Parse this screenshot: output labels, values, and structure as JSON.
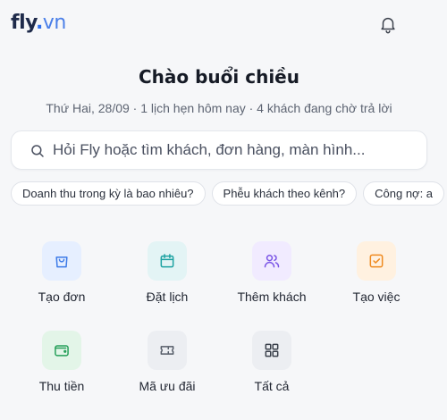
{
  "header": {
    "logo_main": "fly",
    "logo_dot": ".",
    "logo_tld": "vn",
    "bell_icon": "bell-icon"
  },
  "greeting": "Chào buổi chiều",
  "subline": "Thứ Hai, 28/09 · 1 lịch hẹn hôm nay · 4 khách đang chờ trả lời",
  "search": {
    "placeholder": "Hỏi Fly hoặc tìm khách, đơn hàng, màn hình...",
    "icon": "search-icon"
  },
  "chips": [
    "Doanh thu trong kỳ là bao nhiêu?",
    "Phễu khách theo kênh?",
    "Công nợ: a"
  ],
  "actions": [
    {
      "label": "Tạo đơn",
      "icon": "shopping-bag-icon",
      "bg": "#e6efff",
      "fg": "#3d7be8"
    },
    {
      "label": "Đặt lịch",
      "icon": "calendar-icon",
      "bg": "#e3f4f5",
      "fg": "#1fa3a3"
    },
    {
      "label": "Thêm khách",
      "icon": "users-icon",
      "bg": "#f1ebff",
      "fg": "#7b55e6"
    },
    {
      "label": "Tạo việc",
      "icon": "checkbox-icon",
      "bg": "#fff1e0",
      "fg": "#ef8a1f"
    },
    {
      "label": "Thu tiền",
      "icon": "wallet-icon",
      "bg": "#e3f5e8",
      "fg": "#27a05a"
    },
    {
      "label": "Mã ưu đãi",
      "icon": "ticket-icon",
      "bg": "#eceef2",
      "fg": "#555c68"
    },
    {
      "label": "Tất cả",
      "icon": "grid-icon",
      "bg": "#eceef2",
      "fg": "#3a404b"
    }
  ]
}
